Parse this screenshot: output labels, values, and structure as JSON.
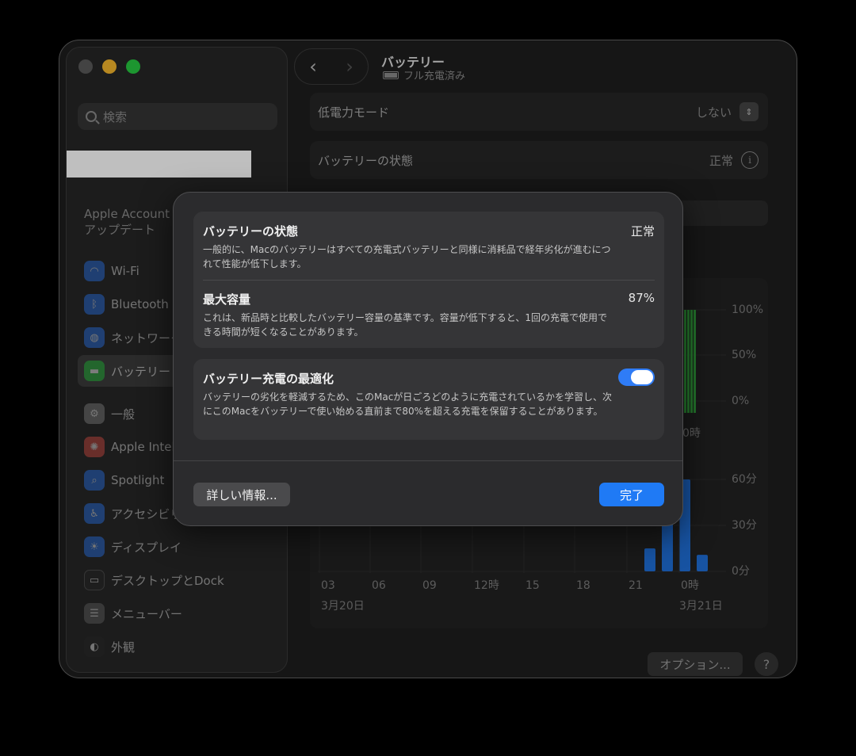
{
  "sidebar": {
    "search_placeholder": "検索",
    "account": [
      "Apple Account",
      "アップデート"
    ],
    "items": [
      {
        "label": "Wi-Fi",
        "icon": "wifi-icon",
        "color": "#2f7cf6"
      },
      {
        "label": "Bluetooth",
        "icon": "bluetooth-icon",
        "color": "#2f7cf6"
      },
      {
        "label": "ネットワーク",
        "icon": "globe-icon",
        "color": "#2f7cf6"
      },
      {
        "label": "バッテリー",
        "icon": "battery-icon",
        "color": "#27c840"
      },
      {
        "label": "一般",
        "icon": "gear-icon",
        "color": "#8a8a8a"
      },
      {
        "label": "Apple Intelligence",
        "icon": "intelligence-icon",
        "color": "#e0524a"
      },
      {
        "label": "Spotlight",
        "icon": "spotlight-icon",
        "color": "#2f7cf6"
      },
      {
        "label": "アクセシビリティ",
        "icon": "accessibility-icon",
        "color": "#2f7cf6"
      },
      {
        "label": "ディスプレイ",
        "icon": "display-icon",
        "color": "#2f7cf6"
      },
      {
        "label": "デスクトップとDock",
        "icon": "dock-icon",
        "color": "#2a2a2a"
      },
      {
        "label": "メニューバー",
        "icon": "menubar-icon",
        "color": "#6a6a6a"
      },
      {
        "label": "外観",
        "icon": "appearance-icon",
        "color": "#2a2a2a"
      }
    ]
  },
  "header": {
    "title": "バッテリー",
    "subtitle": "フル充電済み",
    "back": "‹",
    "forward": "›"
  },
  "settings": {
    "low_power_label": "低電力モード",
    "low_power_value": "しない",
    "health_label": "バッテリーの状態",
    "health_value": "正常"
  },
  "chart": {
    "upper_ticks": [
      "100%",
      "50%",
      "0%"
    ],
    "upper_time": "0時",
    "lower_ticks": [
      "60分",
      "30分",
      "0分"
    ],
    "x_ticks": [
      "03",
      "06",
      "09",
      "12時",
      "15",
      "18",
      "21",
      "0時"
    ],
    "date_left": "3月20日",
    "date_right": "3月21日",
    "lower_bars": [
      25,
      80,
      100,
      18
    ]
  },
  "options_label": "オプション...",
  "help_label": "?",
  "modal": {
    "health_title": "バッテリーの状態",
    "health_value": "正常",
    "health_desc": "一般的に、Macのバッテリーはすべての充電式バッテリーと同様に消耗品で経年劣化が進むにつれて性能が低下します。",
    "capacity_title": "最大容量",
    "capacity_value": "87%",
    "capacity_desc": "これは、新品時と比較したバッテリー容量の基準です。容量が低下すると、1回の充電で使用できる時間が短くなることがあります。",
    "optimize_title": "バッテリー充電の最適化",
    "optimize_desc": "バッテリーの劣化を軽減するため、このMacが日ごろどのように充電されているかを学習し、次にこのMacをバッテリーで使い始める直前まで80%を超える充電を保留することがあります。",
    "more_button": "詳しい情報...",
    "done_button": "完了"
  }
}
